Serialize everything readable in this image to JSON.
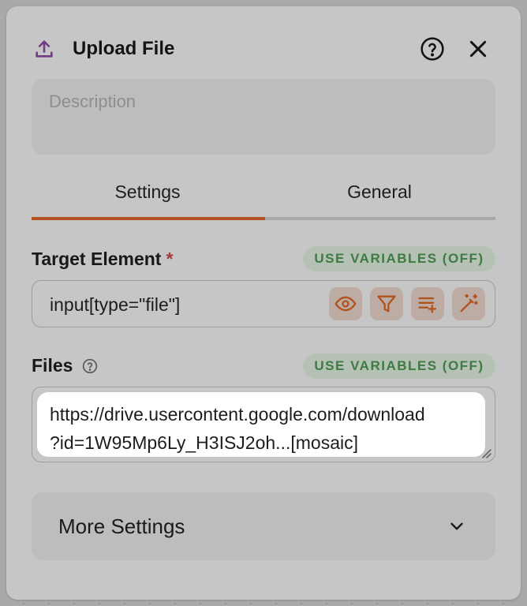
{
  "header": {
    "title": "Upload File",
    "icons": {
      "upload": "upload-icon",
      "help": "help-circle-icon",
      "close": "close-icon"
    }
  },
  "description": {
    "placeholder": "Description",
    "value": ""
  },
  "tabs": [
    {
      "label": "Settings",
      "active": true
    },
    {
      "label": "General",
      "active": false
    }
  ],
  "target_element": {
    "label": "Target Element",
    "required_mark": "*",
    "use_variables": "USE VARIABLES (OFF)",
    "value": "input[type=\"file\"]",
    "buttons": [
      "eye-icon",
      "filter-icon",
      "list-add-icon",
      "magic-wand-icon"
    ]
  },
  "files": {
    "label": "Files",
    "use_variables": "USE VARIABLES (OFF)",
    "line1": "https://drive.usercontent.google.com/download",
    "line2": "?id=1W95Mp6Ly_H3ISJ2oh...[mosaic]"
  },
  "more_settings": {
    "label": "More Settings"
  },
  "colors": {
    "accent": "#b2531f",
    "variables_text": "#3f7a43",
    "required": "#a23a3a",
    "upload_icon": "#6f3a86"
  }
}
